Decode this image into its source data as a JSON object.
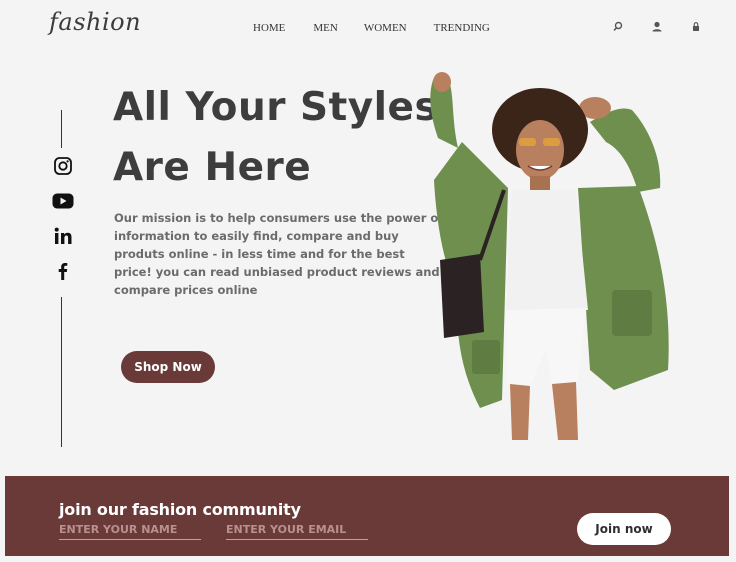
{
  "brand": {
    "logo": "fashion"
  },
  "nav": {
    "items": [
      "HOME",
      "MEN",
      "WOMEN",
      "TRENDING"
    ]
  },
  "header_icons": [
    "search-icon",
    "user-icon",
    "lock-icon"
  ],
  "social": [
    "instagram-icon",
    "youtube-icon",
    "linkedin-icon",
    "facebook-icon"
  ],
  "hero": {
    "title_line1": "All Your Styles",
    "title_line2": "Are Here",
    "description": "Our mission is to help consumers use the power of information to easily find, compare and buy produts online - in less time and for the best price! you can read unbiased product reviews and compare prices online",
    "cta_label": "Shop Now"
  },
  "newsletter": {
    "title": "join our fashion community",
    "name_placeholder": "ENTER YOUR NAME",
    "email_placeholder": "ENTER YOUR EMAIL",
    "button_label": "Join now"
  },
  "colors": {
    "accent": "#6a3a38",
    "text_dark": "#3d3d3d",
    "background": "#f4f4f4"
  }
}
